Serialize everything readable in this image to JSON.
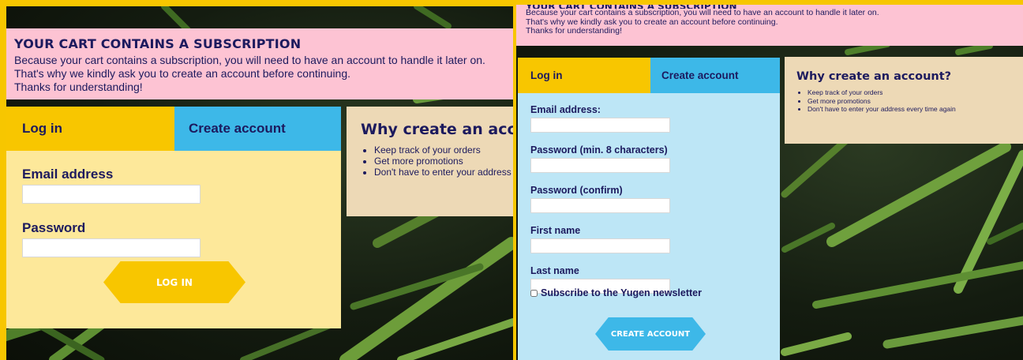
{
  "banner": {
    "title": "YOUR CART CONTAINS A SUBSCRIPTION",
    "lines": [
      "Because your cart contains a subscription, you will need to have an account to handle it later on.",
      "That's why we kindly ask you to create an account before continuing.",
      "Thanks for understanding!"
    ]
  },
  "tabs": {
    "login": "Log in",
    "create": "Create account"
  },
  "login_form": {
    "email_label": "Email address",
    "password_label": "Password",
    "submit_label": "LOG IN"
  },
  "create_form": {
    "email_label": "Email address:",
    "password_label": "Password (min. 8 characters)",
    "password_confirm_label": "Password (confirm)",
    "first_name_label": "First name",
    "last_name_label": "Last name",
    "newsletter_label": "Subscribe to the Yugen newsletter",
    "newsletter_checked": false,
    "submit_label": "CREATE ACCOUNT"
  },
  "why": {
    "title": "Why create an account?",
    "items": [
      "Keep track of your orders",
      "Get more promotions",
      "Don't have to enter your address every time again"
    ]
  },
  "colors": {
    "frame": "#f7c600",
    "banner": "#fdc3d3",
    "login_tab": "#f8c600",
    "login_form": "#fde89a",
    "create_tab": "#3db8e8",
    "create_form": "#bde6f6",
    "why_box": "#edd9b6",
    "text": "#1c1a5e"
  }
}
